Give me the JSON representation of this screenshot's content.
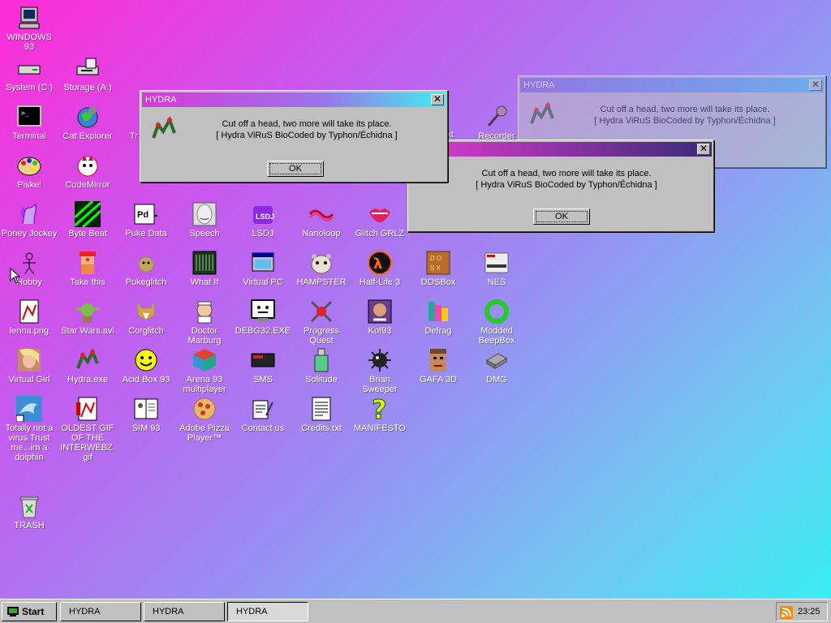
{
  "desktop": {
    "icons": [
      {
        "label": "WINDOWS 93",
        "icon": "computer-icon"
      },
      {
        "label": "System (C:)",
        "icon": "hard-drive-icon"
      },
      {
        "label": "Storage (A:)",
        "icon": "floppy-drive-icon"
      },
      {
        "label": "Terminal",
        "icon": "terminal-icon"
      },
      {
        "label": "Cat Explorer",
        "icon": "cat-globe-icon"
      },
      {
        "label": "Piskel",
        "icon": "palette-icon"
      },
      {
        "label": "CodeMirror",
        "icon": "cat-code-icon"
      },
      {
        "label": "Poney Jockey",
        "icon": "pony-icon"
      },
      {
        "label": "Byte Beat",
        "icon": "bytebeat-icon"
      },
      {
        "label": "Puke Data",
        "icon": "puke-data-icon"
      },
      {
        "label": "Speech",
        "icon": "speech-face-icon"
      },
      {
        "label": "LSDJ",
        "icon": "lsdj-icon"
      },
      {
        "label": "Nanoloop",
        "icon": "nanoloop-icon"
      },
      {
        "label": "Glitch GRLZ",
        "icon": "lips-icon"
      },
      {
        "label": "Hobby",
        "icon": "stickman-icon"
      },
      {
        "label": "Take this",
        "icon": "clown-icon"
      },
      {
        "label": "Pokeglitch",
        "icon": "pokemon-icon"
      },
      {
        "label": "What If",
        "icon": "what-if-icon"
      },
      {
        "label": "Virtual PC",
        "icon": "virtual-pc-icon"
      },
      {
        "label": "HAMPSTER",
        "icon": "hamster-icon"
      },
      {
        "label": "Half-Life 3",
        "icon": "half-life-icon"
      },
      {
        "label": "DOSBox",
        "icon": "dosbox-icon"
      },
      {
        "label": "NES",
        "icon": "nes-icon"
      },
      {
        "label": "lenna.png",
        "icon": "image-file-icon"
      },
      {
        "label": "Star Wars.avi",
        "icon": "yoda-icon"
      },
      {
        "label": "Corglitch",
        "icon": "corgi-icon"
      },
      {
        "label": "Doctor Marburg",
        "icon": "doctor-icon"
      },
      {
        "label": "DEBG32.EXE",
        "icon": "debug-monitor-icon"
      },
      {
        "label": "Progress Quest",
        "icon": "crossed-swords-icon"
      },
      {
        "label": "Kof93",
        "icon": "fighter-icon"
      },
      {
        "label": "Defrag",
        "icon": "defrag-icon"
      },
      {
        "label": "Modded BeepBox",
        "icon": "ring-icon"
      },
      {
        "label": "Virtual Girl",
        "icon": "virtual-girl-icon"
      },
      {
        "label": "Hydra.exe",
        "icon": "hydra-icon"
      },
      {
        "label": "Acid Box 93",
        "icon": "smiley-icon"
      },
      {
        "label": "Arena 93 multiplayer",
        "icon": "cube-icon"
      },
      {
        "label": "SMS",
        "icon": "sms-console-icon"
      },
      {
        "label": "Solitude",
        "icon": "potion-icon"
      },
      {
        "label": "Brian Sweeper",
        "icon": "mine-icon"
      },
      {
        "label": "GAFA 3D",
        "icon": "doom-face-icon"
      },
      {
        "label": "DMG",
        "icon": "dmg-icon"
      },
      {
        "label": "Totally not a virus.Trust me...im a dolphin",
        "icon": "dolphin-icon"
      },
      {
        "label": "OLDEST GIF OF THE INTERWEBZ.gif",
        "icon": "gif-file-icon"
      },
      {
        "label": "SIM 93",
        "icon": "sim-icon"
      },
      {
        "label": "Adobe Pizza Player™",
        "icon": "pizza-icon"
      },
      {
        "label": "Contact us",
        "icon": "contact-icon"
      },
      {
        "label": "Credits.txt",
        "icon": "text-file-icon"
      },
      {
        "label": "MANIFESTO",
        "icon": "question-icon"
      },
      {
        "label": "TRASH",
        "icon": "recycle-bin-icon"
      }
    ],
    "partial_labels": {
      "tr": "Tr",
      "text": "ext",
      "recorder": "Recorder"
    }
  },
  "dialogs": [
    {
      "title": "HYDRA",
      "message_line1": "Cut off a head, two more will take its place.",
      "message_line2": "[ Hydra ViRuS BioCoded by Typhon/Échidna ]",
      "ok_label": "OK",
      "close_label": "✕",
      "title_colors": [
        "#a8a8ff",
        "#3ff0f0"
      ]
    },
    {
      "title": "",
      "message_line1": "Cut off a head, two more will take its place.",
      "message_line2": "[ Hydra ViRuS BioCoded by Typhon/Échidna ]",
      "ok_label": "OK",
      "close_label": "✕"
    },
    {
      "title": "HYDRA",
      "message_line1": "Cut off a head, two more will take its place.",
      "message_line2": "[ Hydra ViRuS BioCoded by Typhon/Échidna ]",
      "close_label": "✕"
    }
  ],
  "taskbar": {
    "start_label": "Start",
    "tasks": [
      "HYDRA",
      "HYDRA",
      "HYDRA"
    ],
    "clock": "23:25"
  }
}
